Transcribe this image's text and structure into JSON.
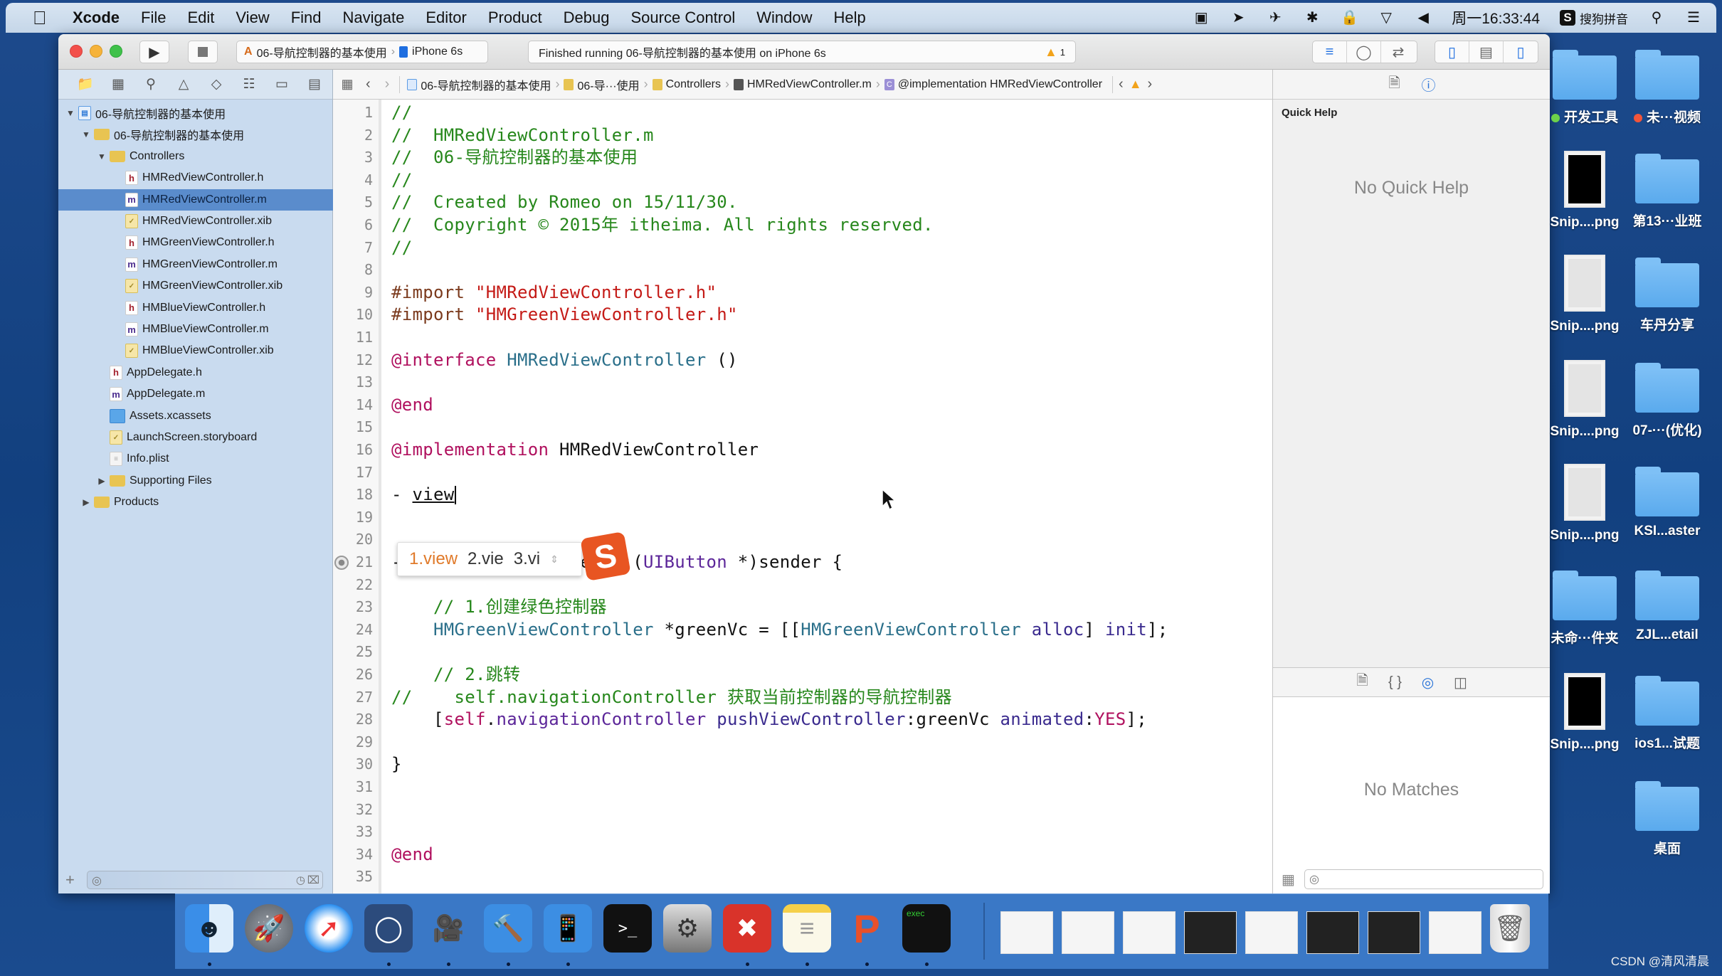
{
  "menubar": {
    "apple": "",
    "items": [
      "Xcode",
      "File",
      "Edit",
      "View",
      "Find",
      "Navigate",
      "Editor",
      "Product",
      "Debug",
      "Source Control",
      "Window",
      "Help"
    ],
    "clock": "周一16:33:44",
    "input_method": "搜狗拼音",
    "status_icons": [
      "screen-record-icon",
      "location-icon",
      "airplane-icon",
      "bluetooth-icon",
      "lock-icon",
      "wifi-icon",
      "volume-icon"
    ]
  },
  "toolbar": {
    "scheme": "06-导航控制器的基本使用",
    "device": "iPhone 6s",
    "activity": "Finished running 06-导航控制器的基本使用 on iPhone 6s",
    "warning_count": "1"
  },
  "navigator": {
    "tree": [
      {
        "label": "06-导航控制器的基本使用",
        "type": "project",
        "depth": 0,
        "expanded": true
      },
      {
        "label": "06-导航控制器的基本使用",
        "type": "folder",
        "depth": 1,
        "expanded": true
      },
      {
        "label": "Controllers",
        "type": "folder",
        "depth": 2,
        "expanded": true
      },
      {
        "label": "HMRedViewController.h",
        "type": "h",
        "depth": 3
      },
      {
        "label": "HMRedViewController.m",
        "type": "m",
        "depth": 3,
        "selected": true
      },
      {
        "label": "HMRedViewController.xib",
        "type": "xib",
        "depth": 3
      },
      {
        "label": "HMGreenViewController.h",
        "type": "h",
        "depth": 3
      },
      {
        "label": "HMGreenViewController.m",
        "type": "m",
        "depth": 3
      },
      {
        "label": "HMGreenViewController.xib",
        "type": "xib",
        "depth": 3
      },
      {
        "label": "HMBlueViewController.h",
        "type": "h",
        "depth": 3
      },
      {
        "label": "HMBlueViewController.m",
        "type": "m",
        "depth": 3
      },
      {
        "label": "HMBlueViewController.xib",
        "type": "xib",
        "depth": 3
      },
      {
        "label": "AppDelegate.h",
        "type": "h",
        "depth": 2
      },
      {
        "label": "AppDelegate.m",
        "type": "m",
        "depth": 2
      },
      {
        "label": "Assets.xcassets",
        "type": "assets",
        "depth": 2
      },
      {
        "label": "LaunchScreen.storyboard",
        "type": "xib",
        "depth": 2
      },
      {
        "label": "Info.plist",
        "type": "plist",
        "depth": 2
      },
      {
        "label": "Supporting Files",
        "type": "folder",
        "depth": 2,
        "expanded": false
      },
      {
        "label": "Products",
        "type": "folder",
        "depth": 1,
        "expanded": false
      }
    ]
  },
  "jumpbar": {
    "crumbs": [
      "06-导航控制器的基本使用",
      "06-导···使用",
      "Controllers",
      "HMRedViewController.m",
      "@implementation HMRedViewController"
    ]
  },
  "editor": {
    "lines": [
      [
        {
          "t": "//",
          "c": "com"
        }
      ],
      [
        {
          "t": "//  HMRedViewController.m",
          "c": "com"
        }
      ],
      [
        {
          "t": "//  06-导航控制器的基本使用",
          "c": "com"
        }
      ],
      [
        {
          "t": "//",
          "c": "com"
        }
      ],
      [
        {
          "t": "//  Created by Romeo on 15/11/30.",
          "c": "com"
        }
      ],
      [
        {
          "t": "//  Copyright © 2015年 itheima. All rights reserved.",
          "c": "com"
        }
      ],
      [
        {
          "t": "//",
          "c": "com"
        }
      ],
      [],
      [
        {
          "t": "#import ",
          "c": "pre"
        },
        {
          "t": "\"HMRedViewController.h\"",
          "c": "str"
        }
      ],
      [
        {
          "t": "#import ",
          "c": "pre"
        },
        {
          "t": "\"HMGreenViewController.h\"",
          "c": "str"
        }
      ],
      [],
      [
        {
          "t": "@interface ",
          "c": "kw"
        },
        {
          "t": "HMRedViewController",
          "c": "cls"
        },
        {
          "t": " ()",
          "c": "plain"
        }
      ],
      [],
      [
        {
          "t": "@end",
          "c": "kw"
        }
      ],
      [],
      [
        {
          "t": "@implementation ",
          "c": "kw"
        },
        {
          "t": "HMRedViewController",
          "c": "plain"
        }
      ],
      [],
      [
        {
          "t": "- ",
          "c": "plain"
        },
        {
          "t": "view",
          "c": "plain",
          "u": true
        }
      ],
      [],
      [],
      [
        {
          "t": "- (",
          "c": "plain"
        },
        {
          "t": "IBAction",
          "c": "kw"
        },
        {
          "t": ")go2GreenVc:(",
          "c": "plain"
        },
        {
          "t": "UIButton",
          "c": "ty"
        },
        {
          "t": " *)sender {",
          "c": "plain"
        }
      ],
      [],
      [
        {
          "t": "    // 1.创建绿色控制器",
          "c": "com"
        }
      ],
      [
        {
          "t": "    HMGreenViewController",
          "c": "cls"
        },
        {
          "t": " *greenVc = [[",
          "c": "plain"
        },
        {
          "t": "HMGreenViewController",
          "c": "cls"
        },
        {
          "t": " ",
          "c": "plain"
        },
        {
          "t": "alloc",
          "c": "method"
        },
        {
          "t": "] ",
          "c": "plain"
        },
        {
          "t": "init",
          "c": "method"
        },
        {
          "t": "];",
          "c": "plain"
        }
      ],
      [],
      [
        {
          "t": "    // 2.跳转",
          "c": "com"
        }
      ],
      [
        {
          "t": "//    self.navigationController 获取当前控制器的导航控制器",
          "c": "com"
        }
      ],
      [
        {
          "t": "    [",
          "c": "plain"
        },
        {
          "t": "self",
          "c": "kw"
        },
        {
          "t": ".",
          "c": "plain"
        },
        {
          "t": "navigationController",
          "c": "ty"
        },
        {
          "t": " ",
          "c": "plain"
        },
        {
          "t": "pushViewController",
          "c": "method"
        },
        {
          "t": ":greenVc ",
          "c": "plain"
        },
        {
          "t": "animated",
          "c": "method"
        },
        {
          "t": ":",
          "c": "plain"
        },
        {
          "t": "YES",
          "c": "kw"
        },
        {
          "t": "];",
          "c": "plain"
        }
      ],
      [],
      [
        {
          "t": "}",
          "c": "plain"
        }
      ],
      [],
      [],
      [],
      [
        {
          "t": "@end",
          "c": "kw"
        }
      ],
      []
    ],
    "breakpoint_line": 21,
    "ime": {
      "candidates": [
        "1.view",
        "2.vie",
        "3.vi"
      ],
      "logo": "S"
    }
  },
  "utility": {
    "quick_help_title": "Quick Help",
    "quick_help_empty": "No Quick Help",
    "library_empty": "No Matches"
  },
  "desktop": {
    "items": [
      {
        "label": "开发工具",
        "kind": "folder",
        "tag": "#6dd14a"
      },
      {
        "label": "未···视频",
        "kind": "folder",
        "tag": "#f2553a"
      },
      {
        "label": "Snip....png",
        "kind": "thumb-dark"
      },
      {
        "label": "第13···业班",
        "kind": "folder"
      },
      {
        "label": "Snip....png",
        "kind": "thumb-light"
      },
      {
        "label": "车丹分享",
        "kind": "folder"
      },
      {
        "label": "Snip....png",
        "kind": "thumb-light"
      },
      {
        "label": "07-···(优化)",
        "kind": "folder"
      },
      {
        "label": "Snip....png",
        "kind": "thumb-light"
      },
      {
        "label": "KSI...aster",
        "kind": "folder"
      },
      {
        "label": "未命···件夹",
        "kind": "folder"
      },
      {
        "label": "ZJL...etail",
        "kind": "folder"
      },
      {
        "label": "Snip....png",
        "kind": "thumb-dark"
      },
      {
        "label": "ios1...试题",
        "kind": "folder"
      },
      {
        "label": "",
        "kind": "none"
      },
      {
        "label": "桌面",
        "kind": "folder"
      }
    ]
  },
  "dock": {
    "apps": [
      "Finder",
      "Launchpad",
      "Safari",
      "Mouse",
      "Screen Recorder",
      "Xcode",
      "Simulator",
      "Terminal",
      "System Preferences",
      "XMind",
      "Notes",
      "Pages/Presenter",
      "Exec Terminal"
    ],
    "running": [
      true,
      false,
      false,
      true,
      true,
      true,
      true,
      false,
      false,
      true,
      true,
      true,
      true
    ]
  },
  "watermark": "CSDN @清风清晨"
}
